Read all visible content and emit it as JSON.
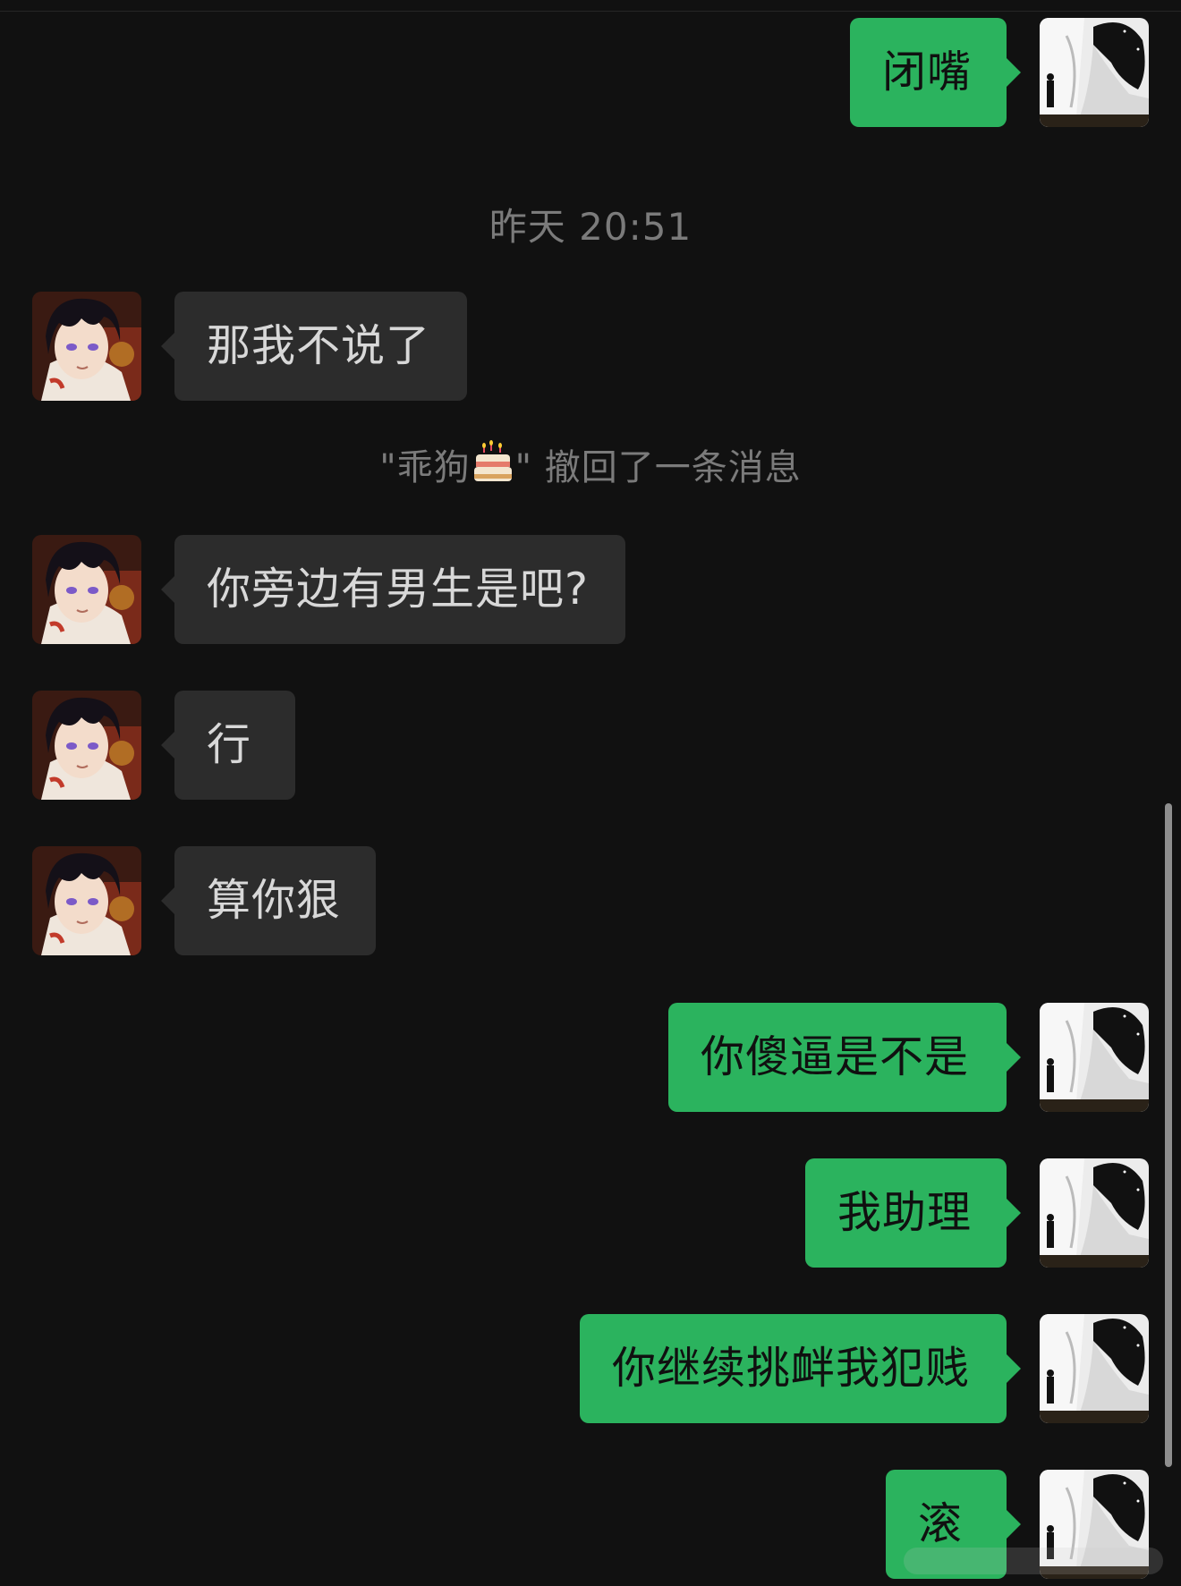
{
  "timestamp": "昨天 20:51",
  "recall_notice": {
    "quote_open": "\"",
    "name": "乖狗",
    "emoji": "🎂",
    "quote_close": "\"",
    "text": " 撤回了一条消息"
  },
  "messages": [
    {
      "side": "out",
      "text": "闭嘴"
    },
    {
      "side": "in",
      "text": "那我不说了"
    },
    {
      "side": "in",
      "text": "你旁边有男生是吧?"
    },
    {
      "side": "in",
      "text": "行"
    },
    {
      "side": "in",
      "text": "算你狠"
    },
    {
      "side": "out",
      "text": "你傻逼是不是"
    },
    {
      "side": "out",
      "text": "我助理"
    },
    {
      "side": "out",
      "text": "你继续挑衅我犯贱"
    },
    {
      "side": "out",
      "text": "滚"
    }
  ],
  "colors": {
    "background": "#111111",
    "incoming_bubble": "#2c2c2c",
    "outgoing_bubble": "#2bb35e",
    "system_text": "#7b7b7b"
  },
  "icons": {
    "contact_avatar": "anime-boy-avatar",
    "self_avatar": "monochrome-anime-avatar"
  }
}
